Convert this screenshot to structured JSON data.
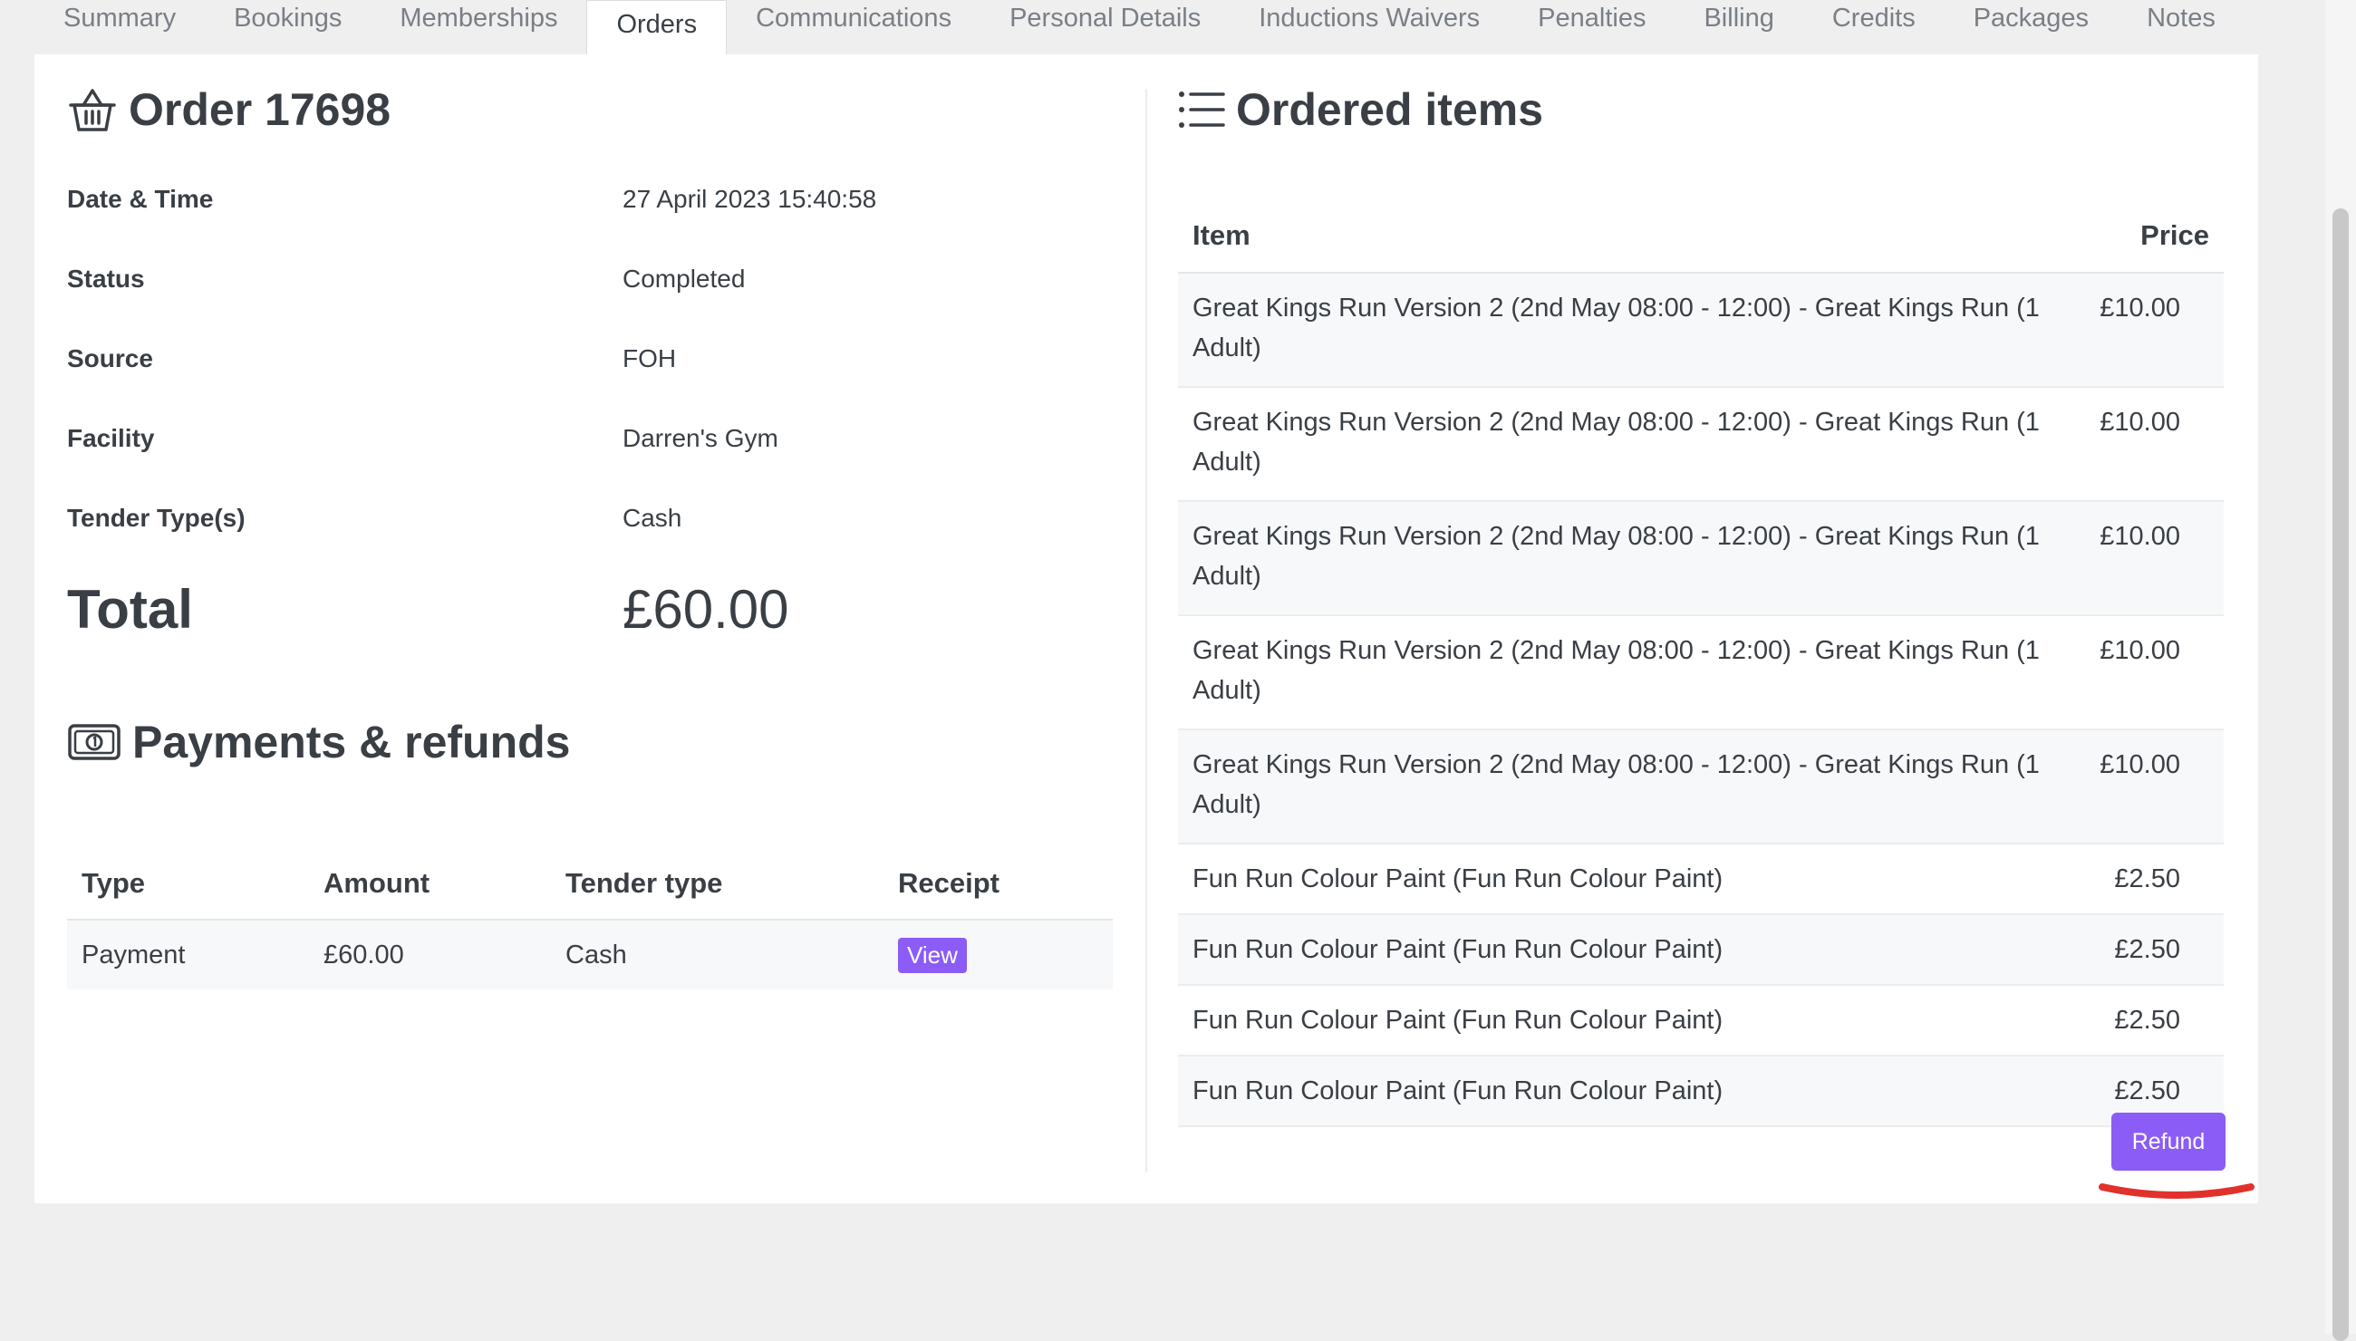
{
  "tabs": [
    {
      "label": "Summary"
    },
    {
      "label": "Bookings"
    },
    {
      "label": "Memberships"
    },
    {
      "label": "Orders"
    },
    {
      "label": "Communications"
    },
    {
      "label": "Personal Details"
    },
    {
      "label": "Inductions Waivers"
    },
    {
      "label": "Penalties"
    },
    {
      "label": "Billing"
    },
    {
      "label": "Credits"
    },
    {
      "label": "Packages"
    },
    {
      "label": "Notes"
    }
  ],
  "active_tab": "Orders",
  "order": {
    "title": "Order 17698",
    "icon": "basket-icon",
    "fields": [
      {
        "label": "Date & Time",
        "value": "27 April 2023 15:40:58"
      },
      {
        "label": "Status",
        "value": "Completed"
      },
      {
        "label": "Source",
        "value": "FOH"
      },
      {
        "label": "Facility",
        "value": "Darren's Gym"
      },
      {
        "label": "Tender Type(s)",
        "value": "Cash"
      }
    ],
    "total_label": "Total",
    "total_value": "£60.00"
  },
  "payments": {
    "title": "Payments & refunds",
    "icon": "banknote-icon",
    "headers": {
      "type": "Type",
      "amount": "Amount",
      "tender": "Tender type",
      "receipt": "Receipt"
    },
    "rows": [
      {
        "type": "Payment",
        "amount": "£60.00",
        "tender": "Cash",
        "receipt": "View"
      }
    ]
  },
  "items": {
    "title": "Ordered items",
    "icon": "list-icon",
    "headers": {
      "item": "Item",
      "price": "Price"
    },
    "rows": [
      {
        "item": "Great Kings Run Version 2 (2nd May 08:00 - 12:00) - Great Kings Run (1 Adult)",
        "price": "£10.00"
      },
      {
        "item": "Great Kings Run Version 2 (2nd May 08:00 - 12:00) - Great Kings Run (1 Adult)",
        "price": "£10.00"
      },
      {
        "item": "Great Kings Run Version 2 (2nd May 08:00 - 12:00) - Great Kings Run (1 Adult)",
        "price": "£10.00"
      },
      {
        "item": "Great Kings Run Version 2 (2nd May 08:00 - 12:00) - Great Kings Run (1 Adult)",
        "price": "£10.00"
      },
      {
        "item": "Great Kings Run Version 2 (2nd May 08:00 - 12:00) - Great Kings Run (1 Adult)",
        "price": "£10.00"
      },
      {
        "item": "Fun Run Colour Paint (Fun Run Colour Paint)",
        "price": "£2.50"
      },
      {
        "item": "Fun Run Colour Paint (Fun Run Colour Paint)",
        "price": "£2.50"
      },
      {
        "item": "Fun Run Colour Paint (Fun Run Colour Paint)",
        "price": "£2.50"
      },
      {
        "item": "Fun Run Colour Paint (Fun Run Colour Paint)",
        "price": "£2.50"
      }
    ],
    "refund_label": "Refund"
  },
  "colors": {
    "accent": "#8b5cf6",
    "annotation": "#e0322b"
  }
}
